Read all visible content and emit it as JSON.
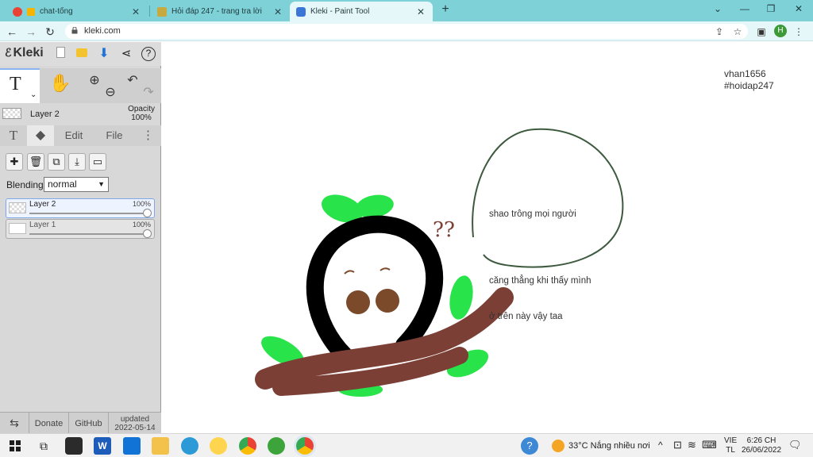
{
  "browser": {
    "tabs": [
      {
        "title": "chat-tổng",
        "color": "#ea4335"
      },
      {
        "title": "Hỏi đáp 247 - trang tra lời",
        "color": "#c6a93f"
      },
      {
        "title": "Kleki - Paint Tool",
        "color": "#3a76d6",
        "active": true
      }
    ],
    "new_tab": "+",
    "url": "kleki.com",
    "profile_initial": "H"
  },
  "app": {
    "logo": "Kleki",
    "layer_bar": {
      "name": "Layer 2",
      "opacity_label": "Opacity",
      "opacity_value": "100%"
    },
    "tabs": {
      "text": "T",
      "edit": "Edit",
      "file": "File",
      "more": "⋮"
    },
    "blending": {
      "label": "Blending",
      "value": "normal"
    },
    "layers": [
      {
        "name": "Layer 2",
        "opacity": "100%",
        "selected": true
      },
      {
        "name": "Layer 1",
        "opacity": "100%",
        "selected": false
      }
    ],
    "footer": {
      "donate": "Donate",
      "github": "GitHub",
      "updated_label": "updated",
      "updated_date": "2022-05-14"
    }
  },
  "canvas": {
    "watermark_user": "vhan1656",
    "watermark_tag": "#hoidap247",
    "question_marks": "??",
    "bubble_lines": [
      "shao trông mọi người",
      "",
      "căng thẳng khi thấy mình",
      "ở trên này vậy taa"
    ],
    "colors": {
      "leaf": "#28e34a",
      "branch": "#7b3f35",
      "head": "#000000",
      "eyes": "#7a4a2a",
      "bubble": "#3d5a3f"
    }
  },
  "taskbar": {
    "weather_temp": "33°C",
    "weather_text": "Nắng nhiều nơi",
    "lang_top": "VIE",
    "lang_bottom": "TL",
    "time": "6:26 CH",
    "date": "26/06/2022"
  }
}
